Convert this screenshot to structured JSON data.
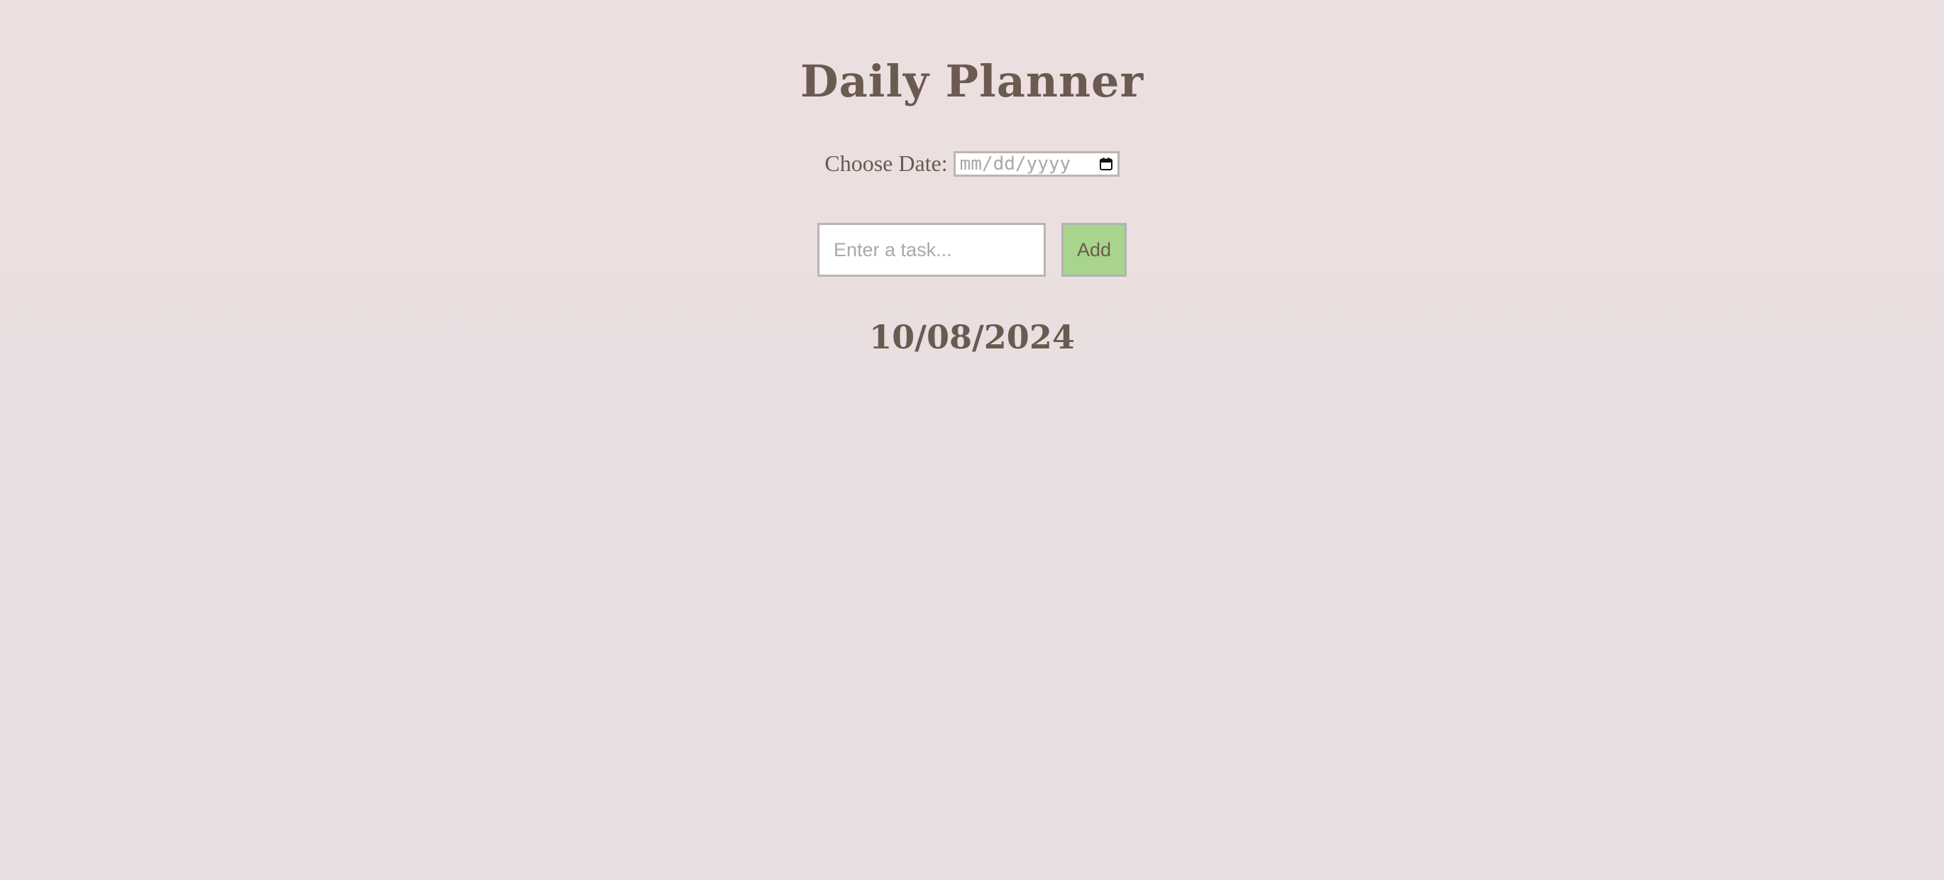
{
  "app": {
    "title": "Daily Planner"
  },
  "date_picker": {
    "label": "Choose Date:",
    "placeholder": "mm/dd/yyyy",
    "icon": "calendar-icon"
  },
  "task_entry": {
    "placeholder": "Enter a task...",
    "value": "",
    "add_label": "Add"
  },
  "selected_date": {
    "text": "10/08/2024"
  },
  "colors": {
    "background": "#ebdfe0",
    "text": "#6b5a50",
    "add_button": "#a8d48d",
    "input_border": "#b9b5b5"
  }
}
